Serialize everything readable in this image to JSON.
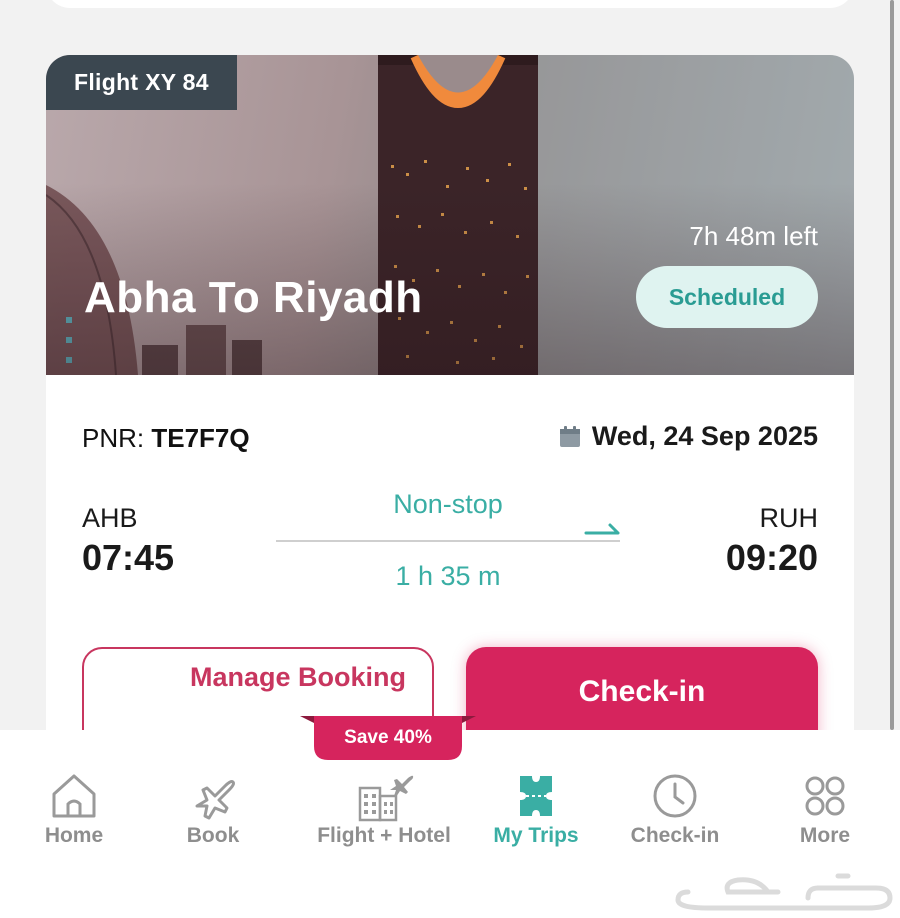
{
  "card": {
    "flight_tag": "Flight XY 84",
    "route_title": "Abha To Riyadh",
    "time_left": "7h 48m left",
    "status": "Scheduled",
    "pnr_label": "PNR:",
    "pnr_code": "TE7F7Q",
    "date": "Wed, 24 Sep 2025",
    "departure": {
      "code": "AHB",
      "time": "07:45"
    },
    "arrival": {
      "code": "RUH",
      "time": "09:20"
    },
    "stops": "Non-stop",
    "duration": "1 h 35 m",
    "manage_label": "Manage Booking",
    "checkin_label": "Check-in"
  },
  "promo": {
    "label": "Save 40%"
  },
  "nav": {
    "items": [
      {
        "label": "Home",
        "icon": "home-icon"
      },
      {
        "label": "Book",
        "icon": "plane-icon"
      },
      {
        "label": "Flight + Hotel",
        "icon": "flight-hotel-icon"
      },
      {
        "label": "My Trips",
        "icon": "ticket-icon",
        "active": true
      },
      {
        "label": "Check-in",
        "icon": "clock-icon"
      },
      {
        "label": "More",
        "icon": "grid-icon"
      }
    ]
  },
  "watermark": {
    "text": "حراج"
  },
  "colors": {
    "brand": "#d6245d",
    "accent_teal": "#3aaea4",
    "badge_bg": "#dff3f0",
    "tag_bg": "#3b4750",
    "nav_inactive": "#8e8e8e"
  }
}
